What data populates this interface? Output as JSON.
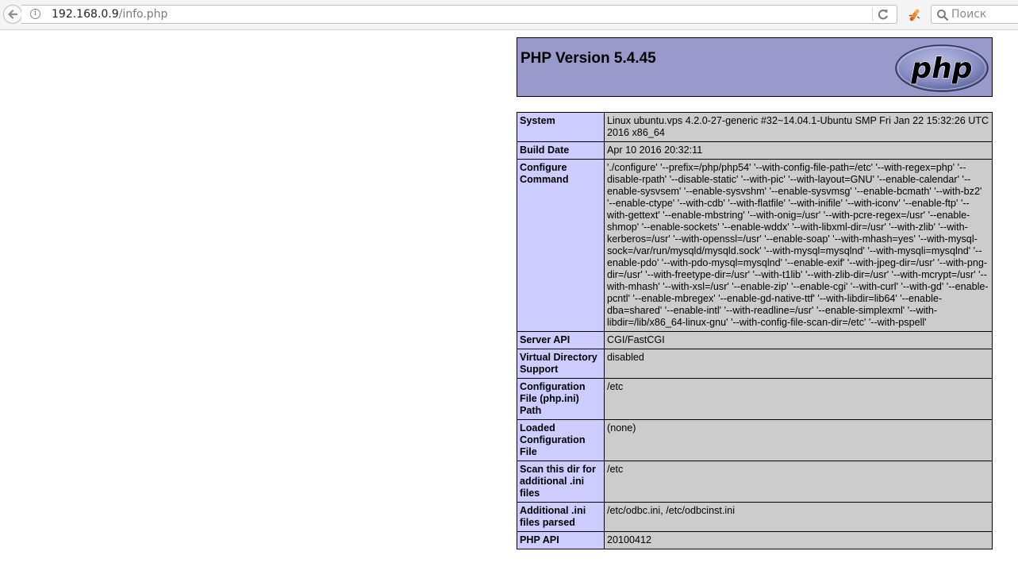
{
  "browser": {
    "url_host": "192.168.0.9",
    "url_path": "/info.php",
    "search_placeholder": "Поиск"
  },
  "header": {
    "title": "PHP Version 5.4.45",
    "logo_text": "php"
  },
  "rows": [
    {
      "label": "System",
      "value": "Linux ubuntu.vps 4.2.0-27-generic #32~14.04.1-Ubuntu SMP Fri Jan 22 15:32:26 UTC 2016 x86_64"
    },
    {
      "label": "Build Date",
      "value": "Apr 10 2016 20:32:11"
    },
    {
      "label": "Configure Command",
      "value": "'./configure' '--prefix=/php/php54' '--with-config-file-path=/etc' '--with-regex=php' '--disable-rpath' '--disable-static' '--with-pic' '--with-layout=GNU' '--enable-calendar' '--enable-sysvsem' '--enable-sysvshm' '--enable-sysvmsg' '--enable-bcmath' '--with-bz2' '--enable-ctype' '--with-cdb' '--with-flatfile' '--with-inifile' '--with-iconv' '--enable-ftp' '--with-gettext' '--enable-mbstring' '--with-onig=/usr' '--with-pcre-regex=/usr' '--enable-shmop' '--enable-sockets' '--enable-wddx' '--with-libxml-dir=/usr' '--with-zlib' '--with-kerberos=/usr' '--with-openssl=/usr' '--enable-soap' '--with-mhash=yes' '--with-mysql-sock=/var/run/mysqld/mysqld.sock' '--with-mysql=mysqlnd' '--with-mysqli=mysqlnd' '--enable-pdo' '--with-pdo-mysql=mysqlnd' '--enable-exif' '--with-jpeg-dir=/usr' '--with-png-dir=/usr' '--with-freetype-dir=/usr' '--with-t1lib' '--with-zlib-dir=/usr' '--with-mcrypt=/usr' '--with-mhash' '--with-xsl=/usr' '--enable-zip' '--enable-cgi' '--with-curl' '--with-gd' '--enable-pcntl' '--enable-mbregex' '--enable-gd-native-ttf' '--with-libdir=lib64' '--enable-dba=shared' '--enable-intl' '--with-readline=/usr' '--enable-simplexml' '--with-libdir=/lib/x86_64-linux-gnu' '--with-config-file-scan-dir=/etc' '--with-pspell'"
    },
    {
      "label": "Server API",
      "value": "CGI/FastCGI"
    },
    {
      "label": "Virtual Directory Support",
      "value": "disabled"
    },
    {
      "label": "Configuration File (php.ini) Path",
      "value": "/etc"
    },
    {
      "label": "Loaded Configuration File",
      "value": "(none)"
    },
    {
      "label": "Scan this dir for additional .ini files",
      "value": "/etc"
    },
    {
      "label": "Additional .ini files parsed",
      "value": "/etc/odbc.ini, /etc/odbcinst.ini"
    },
    {
      "label": "PHP API",
      "value": "20100412"
    }
  ]
}
